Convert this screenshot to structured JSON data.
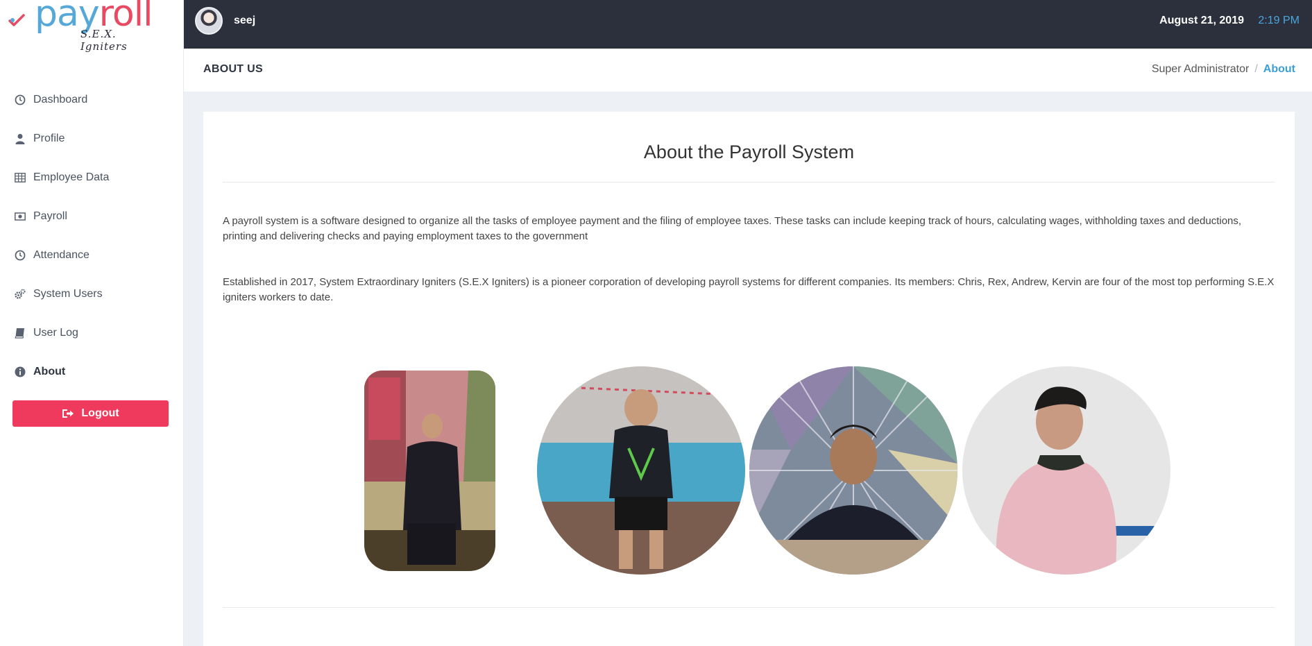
{
  "app": {
    "logo_pay": "pay",
    "logo_roll": "roll",
    "logo_tagline": "S.E.X. Igniters",
    "brand_colors": {
      "blue": "#55a8d8",
      "red": "#e94a63"
    }
  },
  "topbar": {
    "username": "seej",
    "date": "August 21, 2019",
    "time": "2:19 PM"
  },
  "sidebar": {
    "items": [
      {
        "label": "Dashboard",
        "icon": "clock-icon"
      },
      {
        "label": "Profile",
        "icon": "user-icon"
      },
      {
        "label": "Employee Data",
        "icon": "table-icon"
      },
      {
        "label": "Payroll",
        "icon": "money-icon"
      },
      {
        "label": "Attendance",
        "icon": "clock-icon"
      },
      {
        "label": "System Users",
        "icon": "gears-icon"
      },
      {
        "label": "User Log",
        "icon": "book-icon"
      },
      {
        "label": "About",
        "icon": "info-icon",
        "active": true
      }
    ],
    "logout_label": "Logout"
  },
  "header": {
    "title": "ABOUT US",
    "breadcrumb_parent": "Super Administrator",
    "breadcrumb_separator": "/",
    "breadcrumb_current": "About"
  },
  "main": {
    "heading": "About the Payroll System",
    "paragraph_1": "A payroll system is a software designed to organize all the tasks of employee payment and the filing of employee taxes. These tasks can include keeping track of hours, calculating wages, withholding taxes and deductions, printing and delivering checks and paying employment taxes to the government",
    "paragraph_2": "Established in 2017, System Extraordinary Igniters (S.E.X Igniters) is a pioneer corporation of developing payroll systems for different companies. Its members: Chris, Rex, Andrew, Kervin are four of the most top performing S.E.X igniters workers to date."
  }
}
